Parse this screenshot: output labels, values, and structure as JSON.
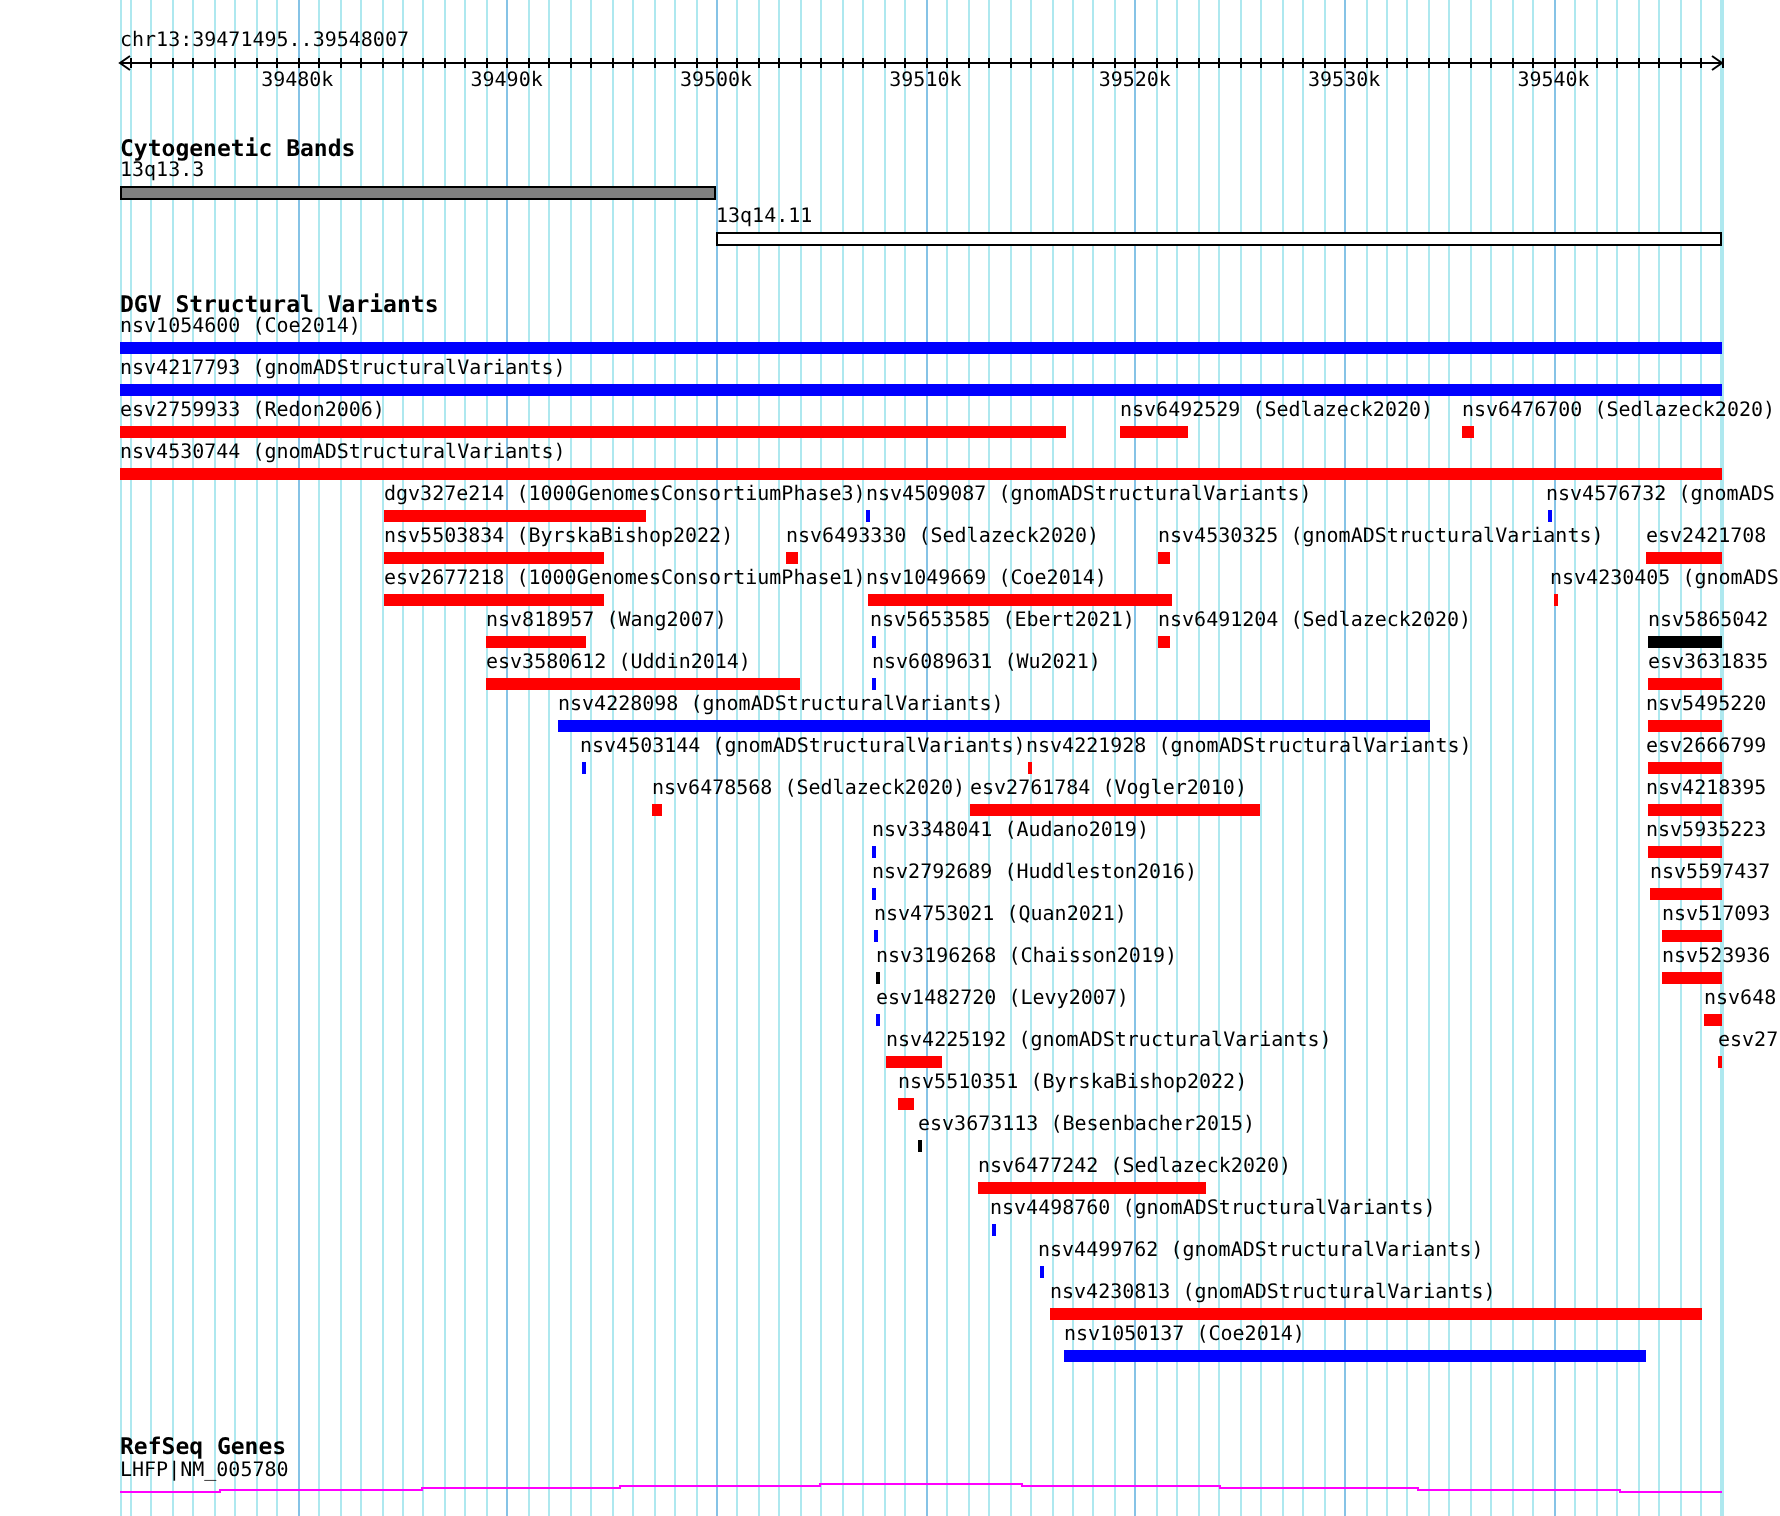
{
  "ruler": {
    "location": "chr13:39471495..39548007",
    "ticks": [
      "39480k",
      "39490k",
      "39500k",
      "39510k",
      "39520k",
      "39530k",
      "39540k"
    ]
  },
  "tracks": [
    {
      "kind": "bands",
      "title": "Cytogenetic Bands",
      "features": [
        {
          "label": "13q13.3",
          "color": "#808080"
        },
        {
          "label": "13q14.11",
          "color": "#ffffff"
        }
      ]
    },
    {
      "kind": "variants",
      "title": "DGV Structural Variants",
      "rows": [
        {
          "features": [
            {
              "label": "nsv1054600 (Coe2014)",
              "color": "#0000ff"
            }
          ]
        },
        {
          "features": [
            {
              "label": "nsv4217793 (gnomADStructuralVariants)",
              "color": "#0000ff"
            }
          ]
        },
        {
          "features": [
            {
              "label": "esv2759933 (Redon2006)",
              "color": "#ff0000"
            },
            {
              "label": "nsv6492529 (Sedlazeck2020)",
              "color": "#ff0000"
            },
            {
              "label": "nsv6476700 (Sedlazeck2020)",
              "color": "#ff0000"
            }
          ]
        },
        {
          "features": [
            {
              "label": "nsv4530744 (gnomADStructuralVariants)",
              "color": "#ff0000"
            }
          ]
        },
        {
          "features": [
            {
              "label": "dgv327e214 (1000GenomesConsortiumPhase3)",
              "color": "#ff0000"
            },
            {
              "label": "nsv4509087 (gnomADStructuralVariants)",
              "color": "#0000ff"
            },
            {
              "label": "nsv4576732 (gnomADS",
              "color": "#0000ff"
            }
          ]
        },
        {
          "features": [
            {
              "label": "nsv5503834 (ByrskaBishop2022)",
              "color": "#ff0000"
            },
            {
              "label": "nsv6493330 (Sedlazeck2020)",
              "color": "#ff0000"
            },
            {
              "label": "nsv4530325 (gnomADStructuralVariants)",
              "color": "#ff0000"
            },
            {
              "label": "esv2421708",
              "color": "#ff0000"
            }
          ]
        },
        {
          "features": [
            {
              "label": "esv2677218 (1000GenomesConsortiumPhase1)",
              "color": "#ff0000"
            },
            {
              "label": "nsv1049669 (Coe2014)",
              "color": "#ff0000"
            },
            {
              "label": "nsv4230405 (gnomADS",
              "color": "#ff0000"
            }
          ]
        },
        {
          "features": [
            {
              "label": "nsv818957 (Wang2007)",
              "color": "#ff0000"
            },
            {
              "label": "nsv5653585 (Ebert2021)",
              "color": "#0000ff"
            },
            {
              "label": "nsv6491204 (Sedlazeck2020)",
              "color": "#ff0000"
            },
            {
              "label": "nsv5865042",
              "color": "#000000"
            }
          ]
        },
        {
          "features": [
            {
              "label": "esv3580612 (Uddin2014)",
              "color": "#ff0000"
            },
            {
              "label": "nsv6089631 (Wu2021)",
              "color": "#0000ff"
            },
            {
              "label": "esv3631835",
              "color": "#ff0000"
            }
          ]
        },
        {
          "features": [
            {
              "label": "nsv4228098 (gnomADStructuralVariants)",
              "color": "#0000ff"
            },
            {
              "label": "nsv5495220",
              "color": "#ff0000"
            }
          ]
        },
        {
          "features": [
            {
              "label": "nsv4503144 (gnomADStructuralVariants)",
              "color": "#0000ff"
            },
            {
              "label": "nsv4221928 (gnomADStructuralVariants)",
              "color": "#ff0000"
            },
            {
              "label": "esv2666799",
              "color": "#ff0000"
            }
          ]
        },
        {
          "features": [
            {
              "label": "nsv6478568 (Sedlazeck2020)",
              "color": "#ff0000"
            },
            {
              "label": "esv2761784 (Vogler2010)",
              "color": "#ff0000"
            },
            {
              "label": "nsv4218395",
              "color": "#ff0000"
            }
          ]
        },
        {
          "features": [
            {
              "label": "nsv3348041 (Audano2019)",
              "color": "#0000ff"
            },
            {
              "label": "nsv5935223",
              "color": "#ff0000"
            }
          ]
        },
        {
          "features": [
            {
              "label": "nsv2792689 (Huddleston2016)",
              "color": "#0000ff"
            },
            {
              "label": "nsv5597437",
              "color": "#ff0000"
            }
          ]
        },
        {
          "features": [
            {
              "label": "nsv4753021 (Quan2021)",
              "color": "#0000ff"
            },
            {
              "label": "nsv517093",
              "color": "#ff0000"
            }
          ]
        },
        {
          "features": [
            {
              "label": "nsv3196268 (Chaisson2019)",
              "color": "#000000"
            },
            {
              "label": "nsv523936",
              "color": "#ff0000"
            }
          ]
        },
        {
          "features": [
            {
              "label": "esv1482720 (Levy2007)",
              "color": "#0000ff"
            },
            {
              "label": "nsv648",
              "color": "#ff0000"
            }
          ]
        },
        {
          "features": [
            {
              "label": "nsv4225192 (gnomADStructuralVariants)",
              "color": "#ff0000"
            },
            {
              "label": "esv27",
              "color": "#ff0000"
            }
          ]
        },
        {
          "features": [
            {
              "label": "nsv5510351 (ByrskaBishop2022)",
              "color": "#ff0000"
            }
          ]
        },
        {
          "features": [
            {
              "label": "esv3673113 (Besenbacher2015)",
              "color": "#000000"
            }
          ]
        },
        {
          "features": [
            {
              "label": "nsv6477242 (Sedlazeck2020)",
              "color": "#ff0000"
            }
          ]
        },
        {
          "features": [
            {
              "label": "nsv4498760 (gnomADStructuralVariants)",
              "color": "#0000ff"
            }
          ]
        },
        {
          "features": [
            {
              "label": "nsv4499762 (gnomADStructuralVariants)",
              "color": "#0000ff"
            }
          ]
        },
        {
          "features": [
            {
              "label": "nsv4230813 (gnomADStructuralVariants)",
              "color": "#ff0000"
            }
          ]
        },
        {
          "features": [
            {
              "label": "nsv1050137 (Coe2014)",
              "color": "#0000ff"
            }
          ]
        }
      ]
    },
    {
      "kind": "genes",
      "title": "RefSeq Genes",
      "features": [
        {
          "label": "LHFP|NM_005780"
        }
      ]
    }
  ]
}
